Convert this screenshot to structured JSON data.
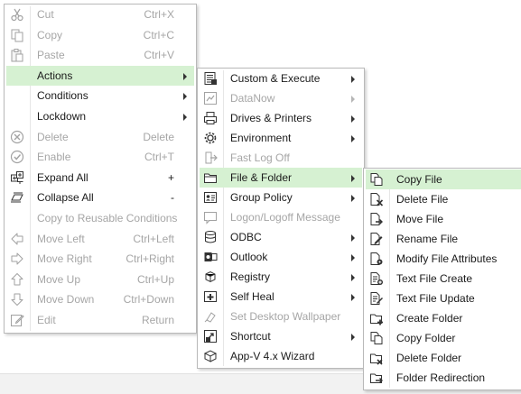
{
  "menu1": {
    "items": [
      {
        "label": "Cut",
        "shortcut": "Ctrl+X",
        "icon": "scissors-icon",
        "disabled": true
      },
      {
        "label": "Copy",
        "shortcut": "Ctrl+C",
        "icon": "copy-icon",
        "disabled": true
      },
      {
        "label": "Paste",
        "shortcut": "Ctrl+V",
        "icon": "paste-icon",
        "disabled": true
      },
      {
        "label": "Actions",
        "submenu": true,
        "selected": true
      },
      {
        "label": "Conditions",
        "submenu": true
      },
      {
        "label": "Lockdown",
        "submenu": true
      },
      {
        "label": "Delete",
        "shortcut": "Delete",
        "icon": "delete-icon",
        "disabled": true
      },
      {
        "label": "Enable",
        "shortcut": "Ctrl+T",
        "icon": "enable-icon",
        "disabled": true
      },
      {
        "label": "Expand All",
        "shortcut": "+",
        "icon": "expand-all-icon"
      },
      {
        "label": "Collapse All",
        "shortcut": "-",
        "icon": "collapse-all-icon"
      },
      {
        "label": "Copy to Reusable Conditions",
        "disabled": true
      },
      {
        "label": "Move Left",
        "shortcut": "Ctrl+Left",
        "icon": "arrow-left-icon",
        "disabled": true
      },
      {
        "label": "Move Right",
        "shortcut": "Ctrl+Right",
        "icon": "arrow-right-icon",
        "disabled": true
      },
      {
        "label": "Move Up",
        "shortcut": "Ctrl+Up",
        "icon": "arrow-up-icon",
        "disabled": true
      },
      {
        "label": "Move Down",
        "shortcut": "Ctrl+Down",
        "icon": "arrow-down-icon",
        "disabled": true
      },
      {
        "label": "Edit",
        "shortcut": "Return",
        "icon": "edit-icon",
        "disabled": true
      }
    ]
  },
  "menu2": {
    "items": [
      {
        "label": "Custom & Execute",
        "submenu": true,
        "icon": "script-icon"
      },
      {
        "label": "DataNow",
        "submenu": true,
        "icon": "datanow-icon",
        "disabled": true
      },
      {
        "label": "Drives & Printers",
        "submenu": true,
        "icon": "printer-icon"
      },
      {
        "label": "Environment",
        "submenu": true,
        "icon": "gear-icon"
      },
      {
        "label": "Fast Log Off",
        "icon": "fast-logoff-icon",
        "disabled": true
      },
      {
        "label": "File & Folder",
        "submenu": true,
        "icon": "folder-icon",
        "selected": true
      },
      {
        "label": "Group Policy",
        "submenu": true,
        "icon": "group-policy-icon"
      },
      {
        "label": "Logon/Logoff Message",
        "icon": "message-icon",
        "disabled": true
      },
      {
        "label": "ODBC",
        "submenu": true,
        "icon": "database-icon"
      },
      {
        "label": "Outlook",
        "submenu": true,
        "icon": "outlook-icon"
      },
      {
        "label": "Registry",
        "submenu": true,
        "icon": "registry-icon"
      },
      {
        "label": "Self Heal",
        "submenu": true,
        "icon": "self-heal-icon"
      },
      {
        "label": "Set Desktop Wallpaper",
        "icon": "wallpaper-icon",
        "disabled": true
      },
      {
        "label": "Shortcut",
        "submenu": true,
        "icon": "shortcut-icon"
      },
      {
        "label": "App-V 4.x Wizard",
        "icon": "appv-icon"
      }
    ]
  },
  "menu3": {
    "items": [
      {
        "label": "Copy File",
        "icon": "copy-file-icon",
        "selected": true
      },
      {
        "label": "Delete File",
        "icon": "delete-file-icon"
      },
      {
        "label": "Move File",
        "icon": "move-file-icon"
      },
      {
        "label": "Rename File",
        "icon": "rename-file-icon"
      },
      {
        "label": "Modify File Attributes",
        "icon": "file-attributes-icon"
      },
      {
        "label": "Text File Create",
        "icon": "text-file-create-icon"
      },
      {
        "label": "Text File Update",
        "icon": "text-file-update-icon"
      },
      {
        "label": "Create Folder",
        "icon": "create-folder-icon"
      },
      {
        "label": "Copy Folder",
        "icon": "copy-folder-icon"
      },
      {
        "label": "Delete Folder",
        "icon": "delete-folder-icon"
      },
      {
        "label": "Folder Redirection",
        "icon": "folder-redirection-icon"
      }
    ]
  }
}
